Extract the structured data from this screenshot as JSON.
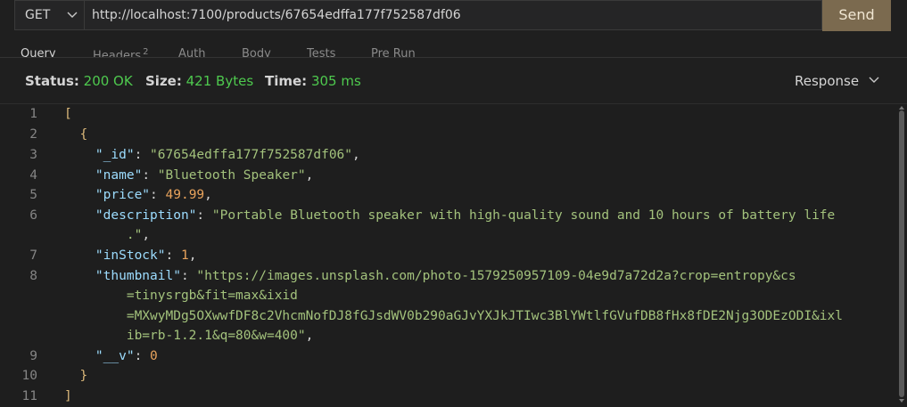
{
  "request": {
    "method": "GET",
    "url": "http://localhost:7100/products/67654edffa177f752587df06",
    "send_label": "Send"
  },
  "tabs": [
    {
      "label": "Query"
    },
    {
      "label": "Headers",
      "badge": "2"
    },
    {
      "label": "Auth"
    },
    {
      "label": "Body"
    },
    {
      "label": "Tests"
    },
    {
      "label": "Pre Run"
    }
  ],
  "status": {
    "status_label": "Status:",
    "status_value": "200 OK",
    "size_label": "Size:",
    "size_value": "421 Bytes",
    "time_label": "Time:",
    "time_value": "305 ms",
    "view_label": "Response"
  },
  "response_lines": [
    {
      "n": "1",
      "parts": [
        [
          "brkt",
          "["
        ]
      ]
    },
    {
      "n": "2",
      "parts": [
        [
          "brkt",
          "  {"
        ]
      ]
    },
    {
      "n": "3",
      "parts": [
        [
          "punc",
          "    "
        ],
        [
          "key",
          "\"_id\""
        ],
        [
          "punc",
          ": "
        ],
        [
          "str",
          "\"67654edffa177f752587df06\""
        ],
        [
          "punc",
          ","
        ]
      ]
    },
    {
      "n": "4",
      "parts": [
        [
          "punc",
          "    "
        ],
        [
          "key",
          "\"name\""
        ],
        [
          "punc",
          ": "
        ],
        [
          "str",
          "\"Bluetooth Speaker\""
        ],
        [
          "punc",
          ","
        ]
      ]
    },
    {
      "n": "5",
      "parts": [
        [
          "punc",
          "    "
        ],
        [
          "key",
          "\"price\""
        ],
        [
          "punc",
          ": "
        ],
        [
          "num",
          "49.99"
        ],
        [
          "punc",
          ","
        ]
      ]
    },
    {
      "n": "6",
      "parts": [
        [
          "punc",
          "    "
        ],
        [
          "key",
          "\"description\""
        ],
        [
          "punc",
          ": "
        ],
        [
          "str",
          "\"Portable Bluetooth speaker with high-quality sound and 10 hours of battery life"
        ]
      ]
    },
    {
      "n": "",
      "parts": [
        [
          "str",
          "        .\""
        ],
        [
          "punc",
          ","
        ]
      ]
    },
    {
      "n": "7",
      "parts": [
        [
          "punc",
          "    "
        ],
        [
          "key",
          "\"inStock\""
        ],
        [
          "punc",
          ": "
        ],
        [
          "num",
          "1"
        ],
        [
          "punc",
          ","
        ]
      ]
    },
    {
      "n": "8",
      "parts": [
        [
          "punc",
          "    "
        ],
        [
          "key",
          "\"thumbnail\""
        ],
        [
          "punc",
          ": "
        ],
        [
          "str",
          "\"https://images.unsplash.com/photo-1579250957109-04e9d7a72d2a?crop=entropy&cs"
        ]
      ]
    },
    {
      "n": "",
      "parts": [
        [
          "str",
          "        =tinysrgb&fit=max&ixid"
        ]
      ]
    },
    {
      "n": "",
      "parts": [
        [
          "str",
          "        =MXwyMDg5OXwwfDF8c2VhcmNofDJ8fGJsdWV0b290aGJvYXJkJTIwc3BlYWtlfGVufDB8fHx8fDE2Njg3ODEzODI&ixl"
        ]
      ]
    },
    {
      "n": "",
      "parts": [
        [
          "str",
          "        ib=rb-1.2.1&q=80&w=400\""
        ],
        [
          "punc",
          ","
        ]
      ]
    },
    {
      "n": "9",
      "parts": [
        [
          "punc",
          "    "
        ],
        [
          "key",
          "\"__v\""
        ],
        [
          "punc",
          ": "
        ],
        [
          "num",
          "0"
        ]
      ]
    },
    {
      "n": "10",
      "parts": [
        [
          "brkt",
          "  }"
        ]
      ]
    },
    {
      "n": "11",
      "parts": [
        [
          "brkt",
          "]"
        ]
      ]
    }
  ],
  "icons": {
    "method_dropdown": "chevron-down-icon",
    "view_dropdown": "chevron-down-icon"
  },
  "colors": {
    "accent_send": "#7b6a4f",
    "status_ok": "#4ec94e",
    "json_key": "#9cdcfe",
    "json_string": "#a3c27c",
    "json_number": "#e8a35c"
  }
}
